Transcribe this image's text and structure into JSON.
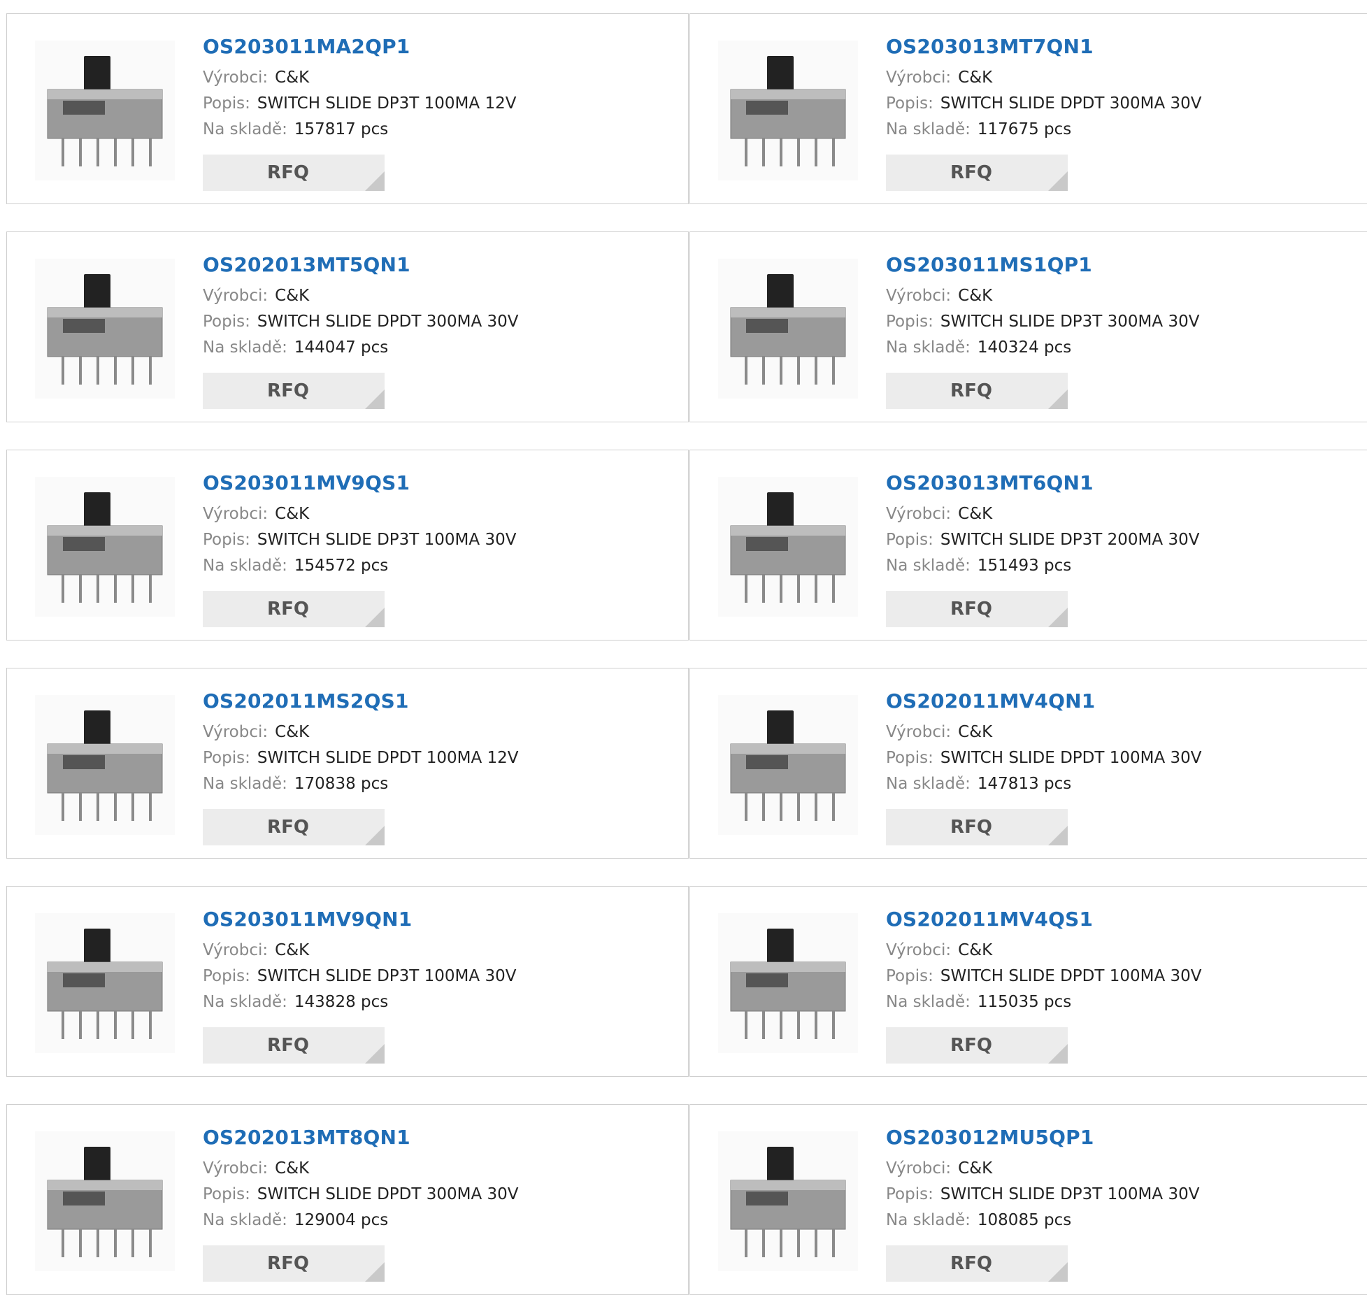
{
  "labels": {
    "manufacturer": "Výrobci:",
    "description": "Popis:",
    "stock": "Na skladě:",
    "rfq": "RFQ"
  },
  "products": [
    {
      "part": "OS203011MA2QP1",
      "manufacturer": "C&K",
      "description": "SWITCH SLIDE DP3T 100MA 12V",
      "stock": "157817 pcs"
    },
    {
      "part": "OS203013MT7QN1",
      "manufacturer": "C&K",
      "description": "SWITCH SLIDE DPDT 300MA 30V",
      "stock": "117675 pcs"
    },
    {
      "part": "OS202013MT5QN1",
      "manufacturer": "C&K",
      "description": "SWITCH SLIDE DPDT 300MA 30V",
      "stock": "144047 pcs"
    },
    {
      "part": "OS203011MS1QP1",
      "manufacturer": "C&K",
      "description": "SWITCH SLIDE DP3T 300MA 30V",
      "stock": "140324 pcs"
    },
    {
      "part": "OS203011MV9QS1",
      "manufacturer": "C&K",
      "description": "SWITCH SLIDE DP3T 100MA 30V",
      "stock": "154572 pcs"
    },
    {
      "part": "OS203013MT6QN1",
      "manufacturer": "C&K",
      "description": "SWITCH SLIDE DP3T 200MA 30V",
      "stock": "151493 pcs"
    },
    {
      "part": "OS202011MS2QS1",
      "manufacturer": "C&K",
      "description": "SWITCH SLIDE DPDT 100MA 12V",
      "stock": "170838 pcs"
    },
    {
      "part": "OS202011MV4QN1",
      "manufacturer": "C&K",
      "description": "SWITCH SLIDE DPDT 100MA 30V",
      "stock": "147813 pcs"
    },
    {
      "part": "OS203011MV9QN1",
      "manufacturer": "C&K",
      "description": "SWITCH SLIDE DP3T 100MA 30V",
      "stock": "143828 pcs"
    },
    {
      "part": "OS202011MV4QS1",
      "manufacturer": "C&K",
      "description": "SWITCH SLIDE DPDT 100MA 30V",
      "stock": "115035 pcs"
    },
    {
      "part": "OS202013MT8QN1",
      "manufacturer": "C&K",
      "description": "SWITCH SLIDE DPDT 300MA 30V",
      "stock": "129004 pcs"
    },
    {
      "part": "OS203012MU5QP1",
      "manufacturer": "C&K",
      "description": "SWITCH SLIDE DP3T 100MA 30V",
      "stock": "108085 pcs"
    }
  ]
}
